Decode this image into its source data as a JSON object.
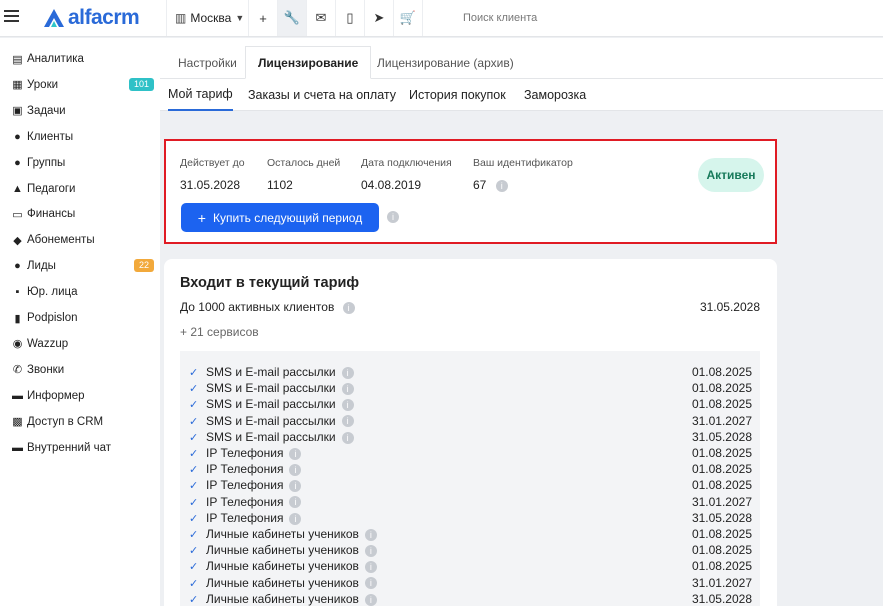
{
  "topbar": {
    "logo_text": "alfacrm",
    "city": "Москва",
    "tools": [
      {
        "icon": "plus-icon",
        "glyph": "+"
      },
      {
        "icon": "wrench-icon",
        "glyph": "🔧"
      },
      {
        "icon": "mail-icon",
        "glyph": "✉"
      },
      {
        "icon": "phone-icon",
        "glyph": "▯"
      },
      {
        "icon": "telegram-icon",
        "glyph": "➤"
      },
      {
        "icon": "cart-icon",
        "glyph": "🛒"
      }
    ],
    "search_placeholder": "Поиск клиента"
  },
  "sidebar": {
    "items": [
      {
        "label": "Аналитика",
        "icon": "analytics-icon",
        "glyph": "▤"
      },
      {
        "label": "Уроки",
        "icon": "lessons-icon",
        "glyph": "▦",
        "badge": "101",
        "badge_color": "#2fc1c7"
      },
      {
        "label": "Задачи",
        "icon": "tasks-icon",
        "glyph": "▣"
      },
      {
        "label": "Клиенты",
        "icon": "client-icon",
        "glyph": "●"
      },
      {
        "label": "Группы",
        "icon": "groups-icon",
        "glyph": "●"
      },
      {
        "label": "Педагоги",
        "icon": "teacher-icon",
        "glyph": "▲"
      },
      {
        "label": "Финансы",
        "icon": "finance-icon",
        "glyph": "▭"
      },
      {
        "label": "Абонементы",
        "icon": "tag-icon",
        "glyph": "◆"
      },
      {
        "label": "Лиды",
        "icon": "leads-icon",
        "glyph": "●",
        "badge": "22",
        "badge_color": "#f2a93b"
      },
      {
        "label": "Юр. лица",
        "icon": "briefcase-icon",
        "glyph": "▪"
      },
      {
        "label": "Podpislon",
        "icon": "document-icon",
        "glyph": "▮"
      },
      {
        "label": "Wazzup",
        "icon": "whatsapp-icon",
        "glyph": "◉"
      },
      {
        "label": "Звонки",
        "icon": "call-icon",
        "glyph": "✆"
      },
      {
        "label": "Информер",
        "icon": "informer-icon",
        "glyph": "▬"
      },
      {
        "label": "Доступ в CRM",
        "icon": "lock-icon",
        "glyph": "▩"
      },
      {
        "label": "Внутренний чат",
        "icon": "chat-icon",
        "glyph": "▬"
      }
    ]
  },
  "tabs_top": [
    "Настройки",
    "Лицензирование",
    "Лицензирование (архив)"
  ],
  "tabs_sub": [
    "Мой тариф",
    "Заказы и счета на оплату",
    "История покупок",
    "Заморозка"
  ],
  "license": {
    "valid_until_label": "Действует до",
    "valid_until": "31.05.2028",
    "days_left_label": "Осталось дней",
    "days_left": "1102",
    "connected_label": "Дата подключения",
    "connected": "04.08.2019",
    "id_label": "Ваш идентификатор",
    "id": "67",
    "status": "Активен",
    "buy_button": "Купить следующий период"
  },
  "tariff": {
    "title": "Входит в текущий тариф",
    "clients_label": "До 1000 активных клиентов",
    "clients_date": "31.05.2028",
    "services_count": "+ 21 сервисов",
    "services": [
      {
        "name": "SMS и E-mail рассылки",
        "date": "01.08.2025"
      },
      {
        "name": "SMS и E-mail рассылки",
        "date": "01.08.2025"
      },
      {
        "name": "SMS и E-mail рассылки",
        "date": "01.08.2025"
      },
      {
        "name": "SMS и E-mail рассылки",
        "date": "31.01.2027"
      },
      {
        "name": "SMS и E-mail рассылки",
        "date": "31.05.2028"
      },
      {
        "name": "IP Телефония",
        "date": "01.08.2025"
      },
      {
        "name": "IP Телефония",
        "date": "01.08.2025"
      },
      {
        "name": "IP Телефония",
        "date": "01.08.2025"
      },
      {
        "name": "IP Телефония",
        "date": "31.01.2027"
      },
      {
        "name": "IP Телефония",
        "date": "31.05.2028"
      },
      {
        "name": "Личные кабинеты учеников",
        "date": "01.08.2025"
      },
      {
        "name": "Личные кабинеты учеников",
        "date": "01.08.2025"
      },
      {
        "name": "Личные кабинеты учеников",
        "date": "01.08.2025"
      },
      {
        "name": "Личные кабинеты учеников",
        "date": "31.01.2027"
      },
      {
        "name": "Личные кабинеты учеников",
        "date": "31.05.2028"
      }
    ]
  },
  "colors": {
    "accent": "#1c63f0",
    "highlight": "#e01b24",
    "active_bg": "#d6f5ec"
  }
}
